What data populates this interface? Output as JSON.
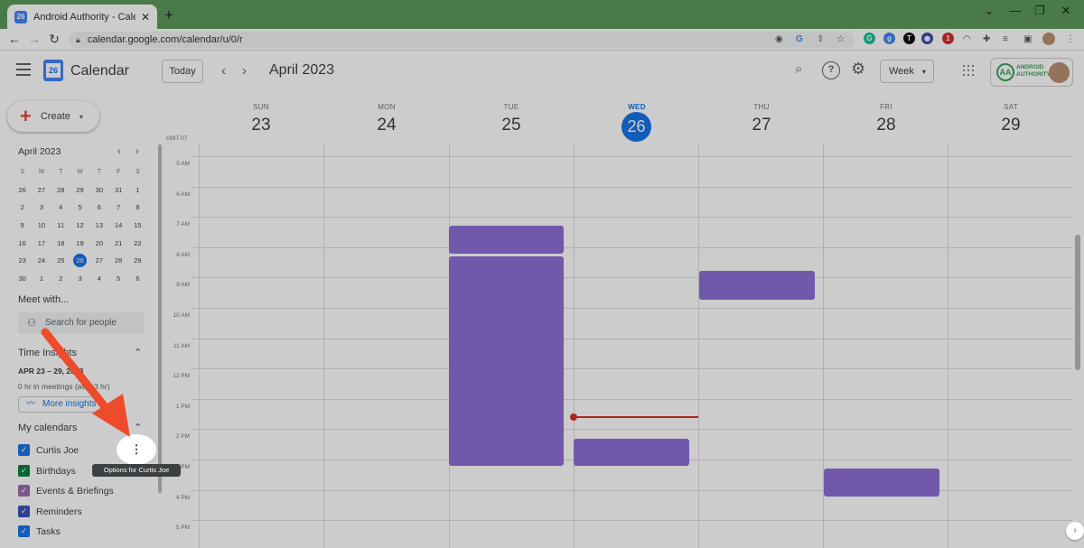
{
  "browser": {
    "tab_title": "Android Authority - Calendar - V",
    "tab_favicon": "26",
    "close_tab": "✕",
    "new_tab": "+",
    "window_controls": [
      "⌄",
      "—",
      "❐",
      "✕"
    ],
    "nav": [
      "←",
      "→",
      "↻"
    ],
    "url": "calendar.google.com/calendar/u/0/r",
    "extensions": [
      {
        "name": "grammarly",
        "label": "G",
        "color": "#15c39a"
      },
      {
        "name": "ext-g",
        "label": "g",
        "color": "#4285f4"
      },
      {
        "name": "ext-t",
        "label": "T",
        "color": "#111111"
      },
      {
        "name": "ext-globe",
        "label": "◉",
        "color": "#3949ab"
      },
      {
        "name": "ext-red",
        "label": "1",
        "color": "#d32f2f"
      }
    ]
  },
  "header": {
    "logo_day": "26",
    "app_title": "Calendar",
    "today_label": "Today",
    "prev": "‹",
    "next": "›",
    "month_title": "April 2023",
    "view_label": "Week",
    "view_caret": "▾",
    "account_brand": "ANDROID AUTHORITY",
    "account_badge": "AA"
  },
  "sidebar": {
    "create_label": "Create",
    "create_plus": "+",
    "mini_month": "April 2023",
    "mini_prev": "‹",
    "mini_next": "›",
    "mini_dow": [
      "S",
      "M",
      "T",
      "W",
      "T",
      "F",
      "S"
    ],
    "mini_days": [
      "26",
      "27",
      "28",
      "29",
      "30",
      "31",
      "1",
      "2",
      "3",
      "4",
      "5",
      "6",
      "7",
      "8",
      "9",
      "10",
      "11",
      "12",
      "13",
      "14",
      "15",
      "16",
      "17",
      "18",
      "19",
      "20",
      "21",
      "22",
      "23",
      "24",
      "25",
      "26",
      "27",
      "28",
      "29",
      "30",
      "1",
      "2",
      "3",
      "4",
      "5",
      "6"
    ],
    "mini_selected_index": 31,
    "meet_label": "Meet with...",
    "search_people": "Search for people",
    "time_insights_label": "Time Insights",
    "ti_range": "APR 23 – 29, 2023",
    "ti_meetings": "0 hr in meetings (avg: 3 hr)",
    "more_insights": "More insights",
    "my_calendars_label": "My calendars",
    "calendars": [
      {
        "label": "Curtis Joe",
        "color": "#1a73e8"
      },
      {
        "label": "Birthdays",
        "color": "#0b8043"
      },
      {
        "label": "Events & Briefings",
        "color": "#9e69af"
      },
      {
        "label": "Reminders",
        "color": "#3f51b5"
      },
      {
        "label": "Tasks",
        "color": "#1a73e8"
      }
    ],
    "options_icon": "⋮",
    "tooltip": "Options for Curtis Joe"
  },
  "week": {
    "timezone": "GMT-07",
    "days": [
      {
        "name": "SUN",
        "num": "23"
      },
      {
        "name": "MON",
        "num": "24"
      },
      {
        "name": "TUE",
        "num": "25"
      },
      {
        "name": "WED",
        "num": "26"
      },
      {
        "name": "THU",
        "num": "27"
      },
      {
        "name": "FRI",
        "num": "28"
      },
      {
        "name": "SAT",
        "num": "29"
      }
    ],
    "hours": [
      "5 AM",
      "6 AM",
      "7 AM",
      "8 AM",
      "9 AM",
      "10 AM",
      "11 AM",
      "12 PM",
      "1 PM",
      "2 PM",
      "3 PM",
      "4 PM",
      "5 PM"
    ],
    "event_color": "#8f6fd6",
    "now_color": "#d93025"
  }
}
